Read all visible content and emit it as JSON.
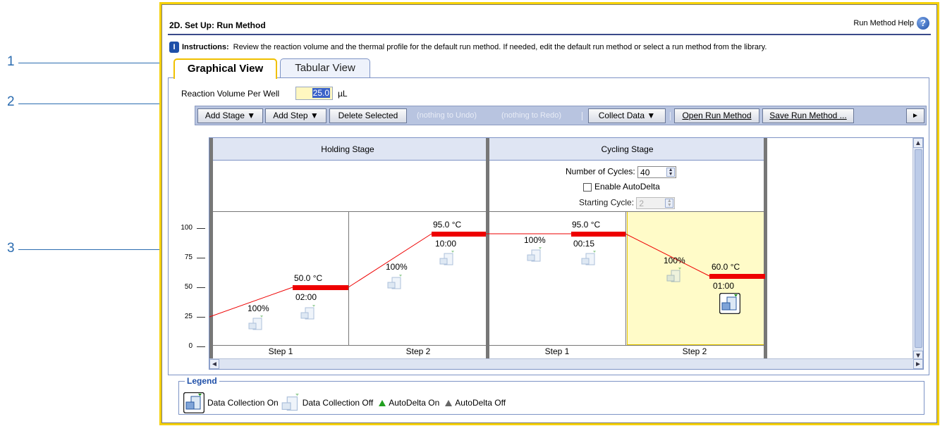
{
  "callouts": [
    "1",
    "2",
    "3"
  ],
  "header": {
    "title": "2D. Set Up: Run Method",
    "help_label": "Run Method Help",
    "help_icon_glyph": "?"
  },
  "instructions": {
    "icon_glyph": "I",
    "label": "Instructions:",
    "text": "Review the reaction volume and the thermal profile for the default run method. If needed, edit the default run method or select a run method from the library."
  },
  "tabs": [
    {
      "label": "Graphical View",
      "active": true
    },
    {
      "label": "Tabular View",
      "active": false
    }
  ],
  "reaction_volume": {
    "label": "Reaction Volume Per Well",
    "value": "25.0",
    "unit": "µL"
  },
  "toolbar": {
    "add_stage": "Add Stage ▼",
    "add_step": "Add Step ▼",
    "delete_selected": "Delete Selected",
    "undo": "(nothing to Undo)",
    "redo": "(nothing to Redo)",
    "collect_data": "Collect Data ▼",
    "open_run_method": "Open Run Method",
    "save_run_method": "Save Run Method ...",
    "more": "►"
  },
  "y_axis": {
    "ticks": [
      "100",
      "75",
      "50",
      "25",
      "0"
    ]
  },
  "stages": [
    {
      "name": "Holding Stage",
      "steps": [
        {
          "label": "Step 1",
          "temp": "50.0 °C",
          "time": "02:00",
          "ramp": "100%"
        },
        {
          "label": "Step 2",
          "temp": "95.0 °C",
          "time": "10:00",
          "ramp": "100%"
        }
      ]
    },
    {
      "name": "Cycling Stage",
      "number_of_cycles_label": "Number of Cycles:",
      "number_of_cycles": "40",
      "enable_autodelta_label": "Enable AutoDelta",
      "starting_cycle_label": "Starting Cycle:",
      "starting_cycle": "2",
      "steps": [
        {
          "label": "Step 1",
          "temp": "95.0 °C",
          "time": "00:15",
          "ramp": "100%"
        },
        {
          "label": "Step 2",
          "temp": "60.0 °C",
          "time": "01:00",
          "ramp": "100%"
        }
      ]
    }
  ],
  "legend": {
    "title": "Legend",
    "data_collection_on": "Data Collection On",
    "data_collection_off": "Data Collection Off",
    "autodelta_on": "AutoDelta On",
    "autodelta_off": "AutoDelta Off"
  },
  "colors": {
    "temp_bar": "#ee0000",
    "selected_step": "#fffbc8",
    "window_border": "#f5d000",
    "autodelta_on": "#22a020",
    "autodelta_off": "#666666"
  },
  "icons": [
    "help-icon",
    "instructions-icon",
    "data-collection-icon",
    "scroll-arrow-icon"
  ]
}
